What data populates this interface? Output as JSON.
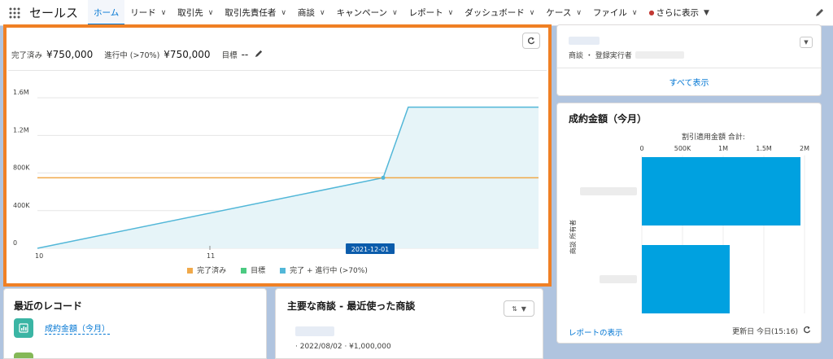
{
  "nav": {
    "app_name": "セールス",
    "items": [
      {
        "label": "ホーム",
        "active": true,
        "chevron": false
      },
      {
        "label": "リード",
        "chevron": true
      },
      {
        "label": "取引先",
        "chevron": true
      },
      {
        "label": "取引先責任者",
        "chevron": true
      },
      {
        "label": "商談",
        "chevron": true
      },
      {
        "label": "キャンペーン",
        "chevron": true
      },
      {
        "label": "レポート",
        "chevron": true
      },
      {
        "label": "ダッシュボード",
        "chevron": true
      },
      {
        "label": "ケース",
        "chevron": true
      },
      {
        "label": "ファイル",
        "chevron": true
      }
    ],
    "more_label": "さらに表示"
  },
  "main_chart": {
    "closed_label": "完了済み",
    "closed_value": "¥750,000",
    "open_label": "進行中 (>70%)",
    "open_value": "¥750,000",
    "goal_label": "目標",
    "goal_value": "--",
    "tooltip_date": "2021-12-01",
    "legend": [
      {
        "label": "完了済み",
        "color": "#f0a94a"
      },
      {
        "label": "目標",
        "color": "#4bca81"
      },
      {
        "label": "完了 + 進行中 (>70%)",
        "color": "#52b7d8"
      }
    ]
  },
  "chart_data": [
    {
      "type": "line",
      "x_ticks": [
        "10",
        "11"
      ],
      "y_ticks": [
        "0",
        "400K",
        "800K",
        "1.2M",
        "1.6M"
      ],
      "ylim": [
        0,
        1800000
      ],
      "series": [
        {
          "name": "完了済み",
          "points": [
            [
              0,
              750000
            ],
            [
              1,
              750000
            ]
          ]
        },
        {
          "name": "完了 + 進行中 (>70%)",
          "points": [
            [
              0,
              0
            ],
            [
              0.69,
              750000
            ],
            [
              0.74,
              1500000
            ],
            [
              1,
              1500000
            ]
          ]
        }
      ],
      "grid": true,
      "legend_position": "bottom"
    },
    {
      "type": "bar",
      "title": "成約金額（今月）",
      "x_axis_title": "割引適用金額 合計:",
      "y_axis_title": "商談 所有者",
      "x_ticks": [
        "0",
        "500K",
        "1M",
        "1.5M",
        "2M"
      ],
      "xlim": [
        0,
        2000000
      ],
      "values": [
        1950000,
        1080000
      ],
      "color": "#00a1e0"
    }
  ],
  "right_top": {
    "subtitle": "商談 ・ 登録実行者",
    "view_all": "すべて表示"
  },
  "bar_card": {
    "report_link": "レポートの表示",
    "updated": "更新日 今日(15:16)"
  },
  "recent": {
    "title": "最近のレコード",
    "item_label": "成約金額（今月）"
  },
  "opps": {
    "title": "主要な商談 - 最近使った商談",
    "meta": "· 2022/08/02 · ¥1,000,000"
  }
}
